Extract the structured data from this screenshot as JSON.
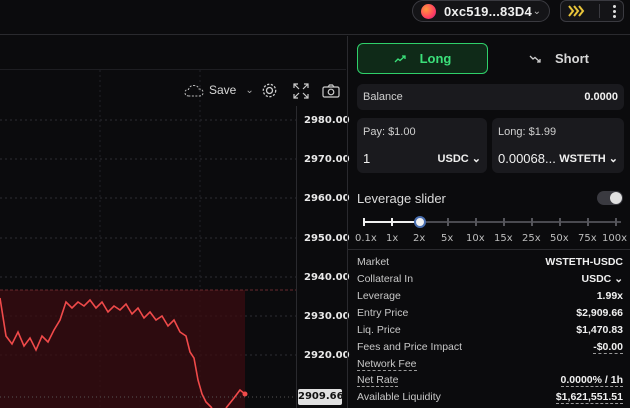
{
  "header": {
    "wallet_address": "0xc519...83D4"
  },
  "chart_toolbar": {
    "save_label": "Save"
  },
  "chart": {
    "price_ticks": [
      "2980.00",
      "2970.00",
      "2960.00",
      "2950.00",
      "2940.00",
      "2930.00",
      "2920.00"
    ],
    "current_price": "2909.66",
    "line_color": "#f04a4a"
  },
  "trade_tabs": {
    "long_label": "Long",
    "short_label": "Short"
  },
  "balance": {
    "label": "Balance",
    "value": "0.0000"
  },
  "pay": {
    "label": "Pay: $1.00",
    "amount": "1",
    "token": "USDC"
  },
  "long": {
    "label": "Long: $1.99",
    "amount": "0.00068...",
    "token": "WSTETH"
  },
  "leverage": {
    "title": "Leverage slider",
    "marks": [
      "0.1x",
      "1x",
      "2x",
      "5x",
      "10x",
      "15x",
      "25x",
      "50x",
      "75x",
      "100x"
    ],
    "selected": "2x"
  },
  "details": [
    {
      "key": "Market",
      "value": "WSTETH-USDC"
    },
    {
      "key": "Collateral In",
      "value": "USDC"
    },
    {
      "key": "Leverage",
      "value": "1.99x"
    },
    {
      "key": "Entry Price",
      "value": "$2,909.66"
    },
    {
      "key": "Liq. Price",
      "value": "$1,470.83"
    },
    {
      "key": "Fees and Price Impact",
      "value": "-$0.00"
    },
    {
      "key": "Network Fee",
      "value": ""
    },
    {
      "key": "Net Rate",
      "value": "0.0000% / 1h"
    },
    {
      "key": "Available Liquidity",
      "value": "$1,621,551.51"
    }
  ]
}
